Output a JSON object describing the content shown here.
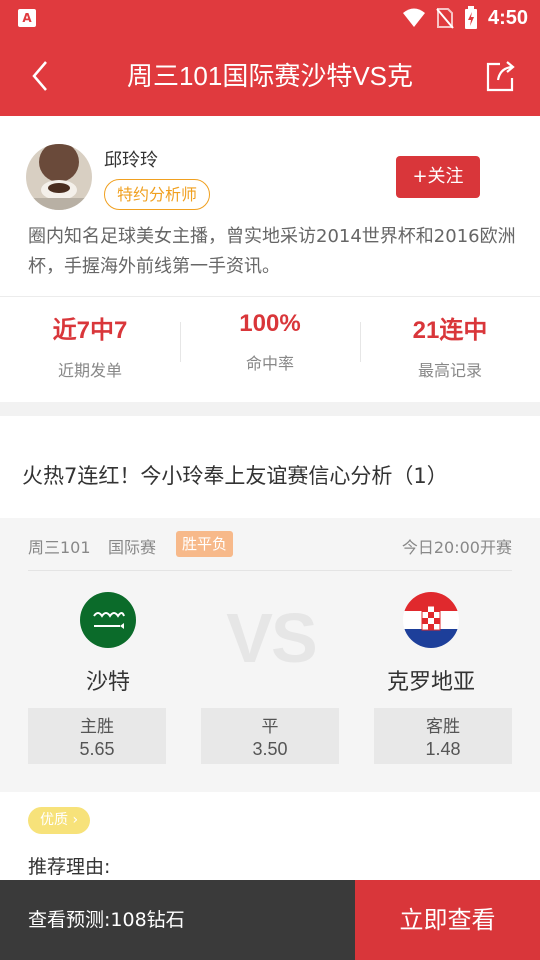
{
  "statusbar": {
    "app_icon": "A",
    "time": "4:50"
  },
  "header": {
    "title": "周三101国际赛沙特VS克"
  },
  "analyst": {
    "name": "邱玲玲",
    "badge": "特约分析师",
    "follow_label": "+关注",
    "bio": "圈内知名足球美女主播，曾实地采访2014世界杯和2016欧洲杯，手握海外前线第一手资讯。",
    "stats": [
      {
        "value": "近7中7",
        "label": "近期发单"
      },
      {
        "value": "100%",
        "label": "命中率"
      },
      {
        "value": "21连中",
        "label": "最高记录"
      }
    ]
  },
  "article": {
    "title": "火热7连红！今小玲奉上友谊赛信心分析（1）"
  },
  "match": {
    "code": "周三101",
    "league": "国际赛",
    "bet_type": "胜平负",
    "kickoff": "今日20:00开赛",
    "vs_label": "VS",
    "home_team": "沙特",
    "away_team": "克罗地亚",
    "odds": [
      {
        "label": "主胜",
        "value": "5.65"
      },
      {
        "label": "平",
        "value": "3.50"
      },
      {
        "label": "客胜",
        "value": "1.48"
      }
    ]
  },
  "reason": {
    "quality_tag": "优质",
    "label": "推荐理由:"
  },
  "bottom": {
    "price_text": "查看预测:108钻石",
    "button_label": "立即查看"
  },
  "colors": {
    "primary": "#e03a3e",
    "accent": "#d9363a",
    "badge": "#f0a020",
    "dark": "#3a3a3a"
  }
}
